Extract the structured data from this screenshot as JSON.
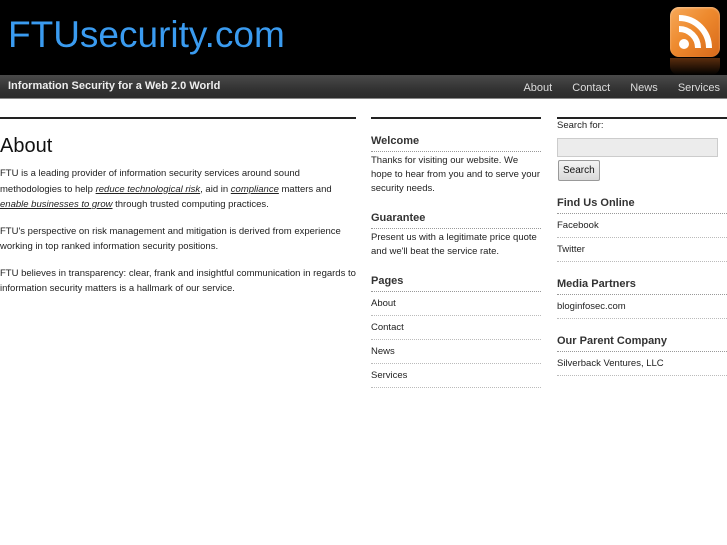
{
  "header": {
    "site_title": "FTUsecurity.com",
    "tagline": "Information Security for a Web 2.0 World",
    "rss_icon": "rss-feed-icon",
    "nav": [
      "About",
      "Contact",
      "News",
      "Services"
    ]
  },
  "main": {
    "title": "About",
    "paragraphs": [
      {
        "before": "FTU is a leading provider of information security services around sound methodologies to help ",
        "link1": "reduce technological risk",
        "mid1": ", aid in ",
        "link2": "compliance",
        "mid2": " matters and ",
        "link3": "enable businesses to grow",
        "after": " through trusted computing practices."
      },
      {
        "text": "FTU's perspective on risk management and mitigation is derived from experience working in top ranked information security positions."
      },
      {
        "text": "FTU believes in transparency: clear, frank and insightful communication in regards to information security matters is a hallmark of our service."
      }
    ]
  },
  "sidebar1": {
    "welcome": {
      "title": "Welcome",
      "text": "Thanks for visiting our website. We hope to hear from you and to serve your security needs."
    },
    "guarantee": {
      "title": "Guarantee",
      "text": "Present us with a legitimate price quote and we'll beat the service rate."
    },
    "pages": {
      "title": "Pages",
      "items": [
        "About",
        "Contact",
        "News",
        "Services"
      ]
    }
  },
  "sidebar2": {
    "search": {
      "label": "Search for:",
      "value": "",
      "placeholder": "",
      "button": "Search"
    },
    "find_us": {
      "title": "Find Us Online",
      "items": [
        "Facebook",
        "Twitter"
      ]
    },
    "media": {
      "title": "Media Partners",
      "items": [
        "bloginfosec.com"
      ]
    },
    "parent": {
      "title": "Our Parent Company",
      "items": [
        "Silverback Ventures, LLC"
      ]
    }
  },
  "colors": {
    "title_blue": "#3a9bf0",
    "rss_orange": "#ee8a2e",
    "header_bg": "#000000"
  }
}
